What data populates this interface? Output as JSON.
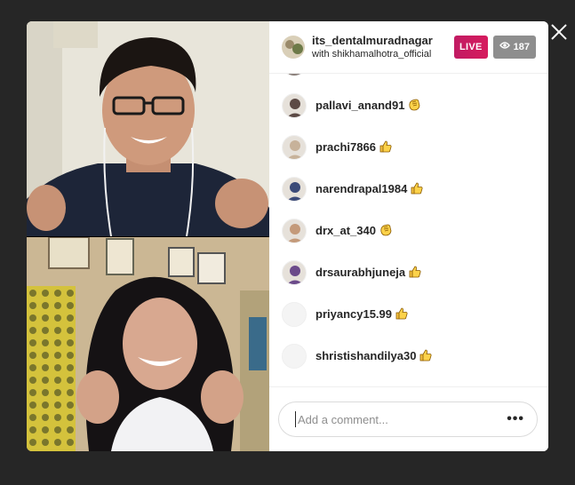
{
  "header": {
    "host_username": "its_dentalmuradnagar",
    "with_text": "with shikhamalhotra_official",
    "live_label": "LIVE",
    "viewer_count": "187"
  },
  "comments": [
    {
      "username": "",
      "emoji": "none"
    },
    {
      "username": "pallavi_anand91",
      "emoji": "clap-emoji"
    },
    {
      "username": "prachi7866",
      "emoji": "thumbs-up-emoji"
    },
    {
      "username": "narendrapal1984",
      "emoji": "thumbs-up-emoji"
    },
    {
      "username": "drx_at_340",
      "emoji": "clap-emoji"
    },
    {
      "username": "drsaurabhjuneja",
      "emoji": "thumbs-up-emoji"
    },
    {
      "username": "priyancy15.99",
      "emoji": "thumbs-up-emoji"
    },
    {
      "username": "shristishandilya30",
      "emoji": "thumbs-up-emoji"
    }
  ],
  "footer": {
    "comment_placeholder": "Add a comment...",
    "more_label": "•••"
  },
  "colors": {
    "live_badge": "#c8195f",
    "viewer_badge": "#8e8e8e",
    "backdrop": "#262626"
  }
}
